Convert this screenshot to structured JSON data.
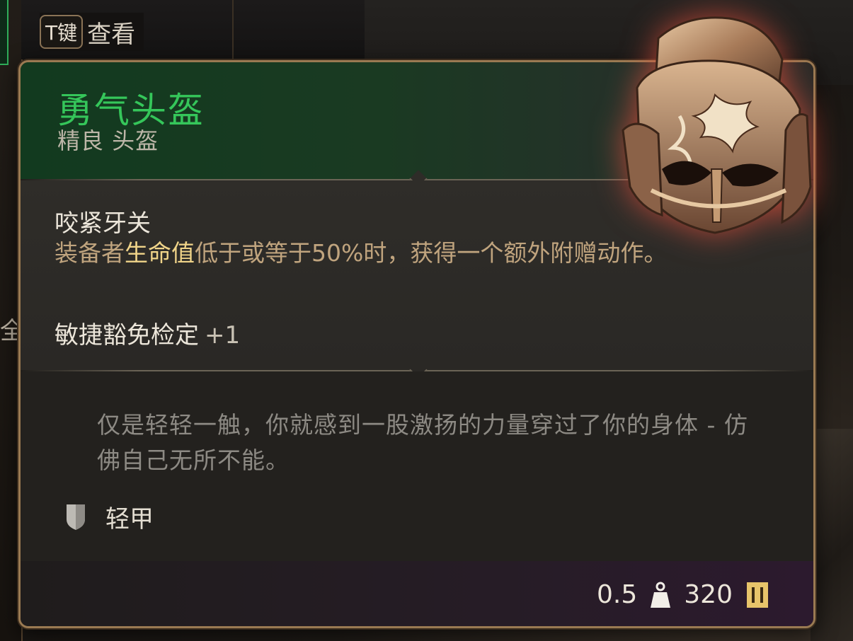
{
  "hud": {
    "key": "T键",
    "key_action": "查看",
    "side_char": "全"
  },
  "item": {
    "name": "勇气头盔",
    "type_line": "精良 头盔",
    "name_color": "#35c65a",
    "icon": "helmet-art"
  },
  "property": {
    "title": "咬紧牙关",
    "desc_before": "装备者",
    "desc_highlight": "生命值",
    "desc_after": "低于或等于50%时，获得一个额外附赠动作。"
  },
  "stat": {
    "label": "敏捷豁免检定",
    "bonus": "+1"
  },
  "flavor": "仅是轻轻一触，你就感到一股激扬的力量穿过了你的身体 - 仿佛自己无所不能。",
  "armor": {
    "icon": "shield-icon",
    "label": "轻甲"
  },
  "footer": {
    "weight": "0.5",
    "weight_icon": "weight-icon",
    "value": "320",
    "value_icon": "coin-icon"
  }
}
